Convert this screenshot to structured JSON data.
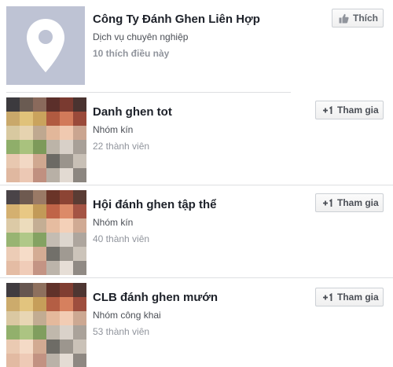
{
  "items": [
    {
      "kind": "page",
      "title": "Công Ty Đánh Ghen Liên Hợp",
      "subtitle": "Dịch vụ chuyên nghiệp",
      "meta": "10 thích điều này",
      "action_label": "Thích",
      "action_icon": "thumbs-up-icon",
      "thumbnail_icon": "map-pin-icon"
    },
    {
      "kind": "group",
      "title": "Danh ghen tot",
      "subtitle": "Nhóm kín",
      "meta": "22 thành viên",
      "action_label": "Tham gia",
      "action_icon": "plus-one-icon"
    },
    {
      "kind": "group",
      "title": "Hội đánh ghen tập thể",
      "subtitle": "Nhóm kín",
      "meta": "40 thành viên",
      "action_label": "Tham gia",
      "action_icon": "plus-one-icon"
    },
    {
      "kind": "group",
      "title": "CLB đánh ghen mướn",
      "subtitle": "Nhóm công khai",
      "meta": "53 thành viên",
      "action_label": "Tham gia",
      "action_icon": "plus-one-icon"
    }
  ],
  "colors": {
    "page_thumb_bg": "#bec3d4",
    "title": "#1d2129",
    "secondary_text": "#4b4f56",
    "meta_text": "#90949c"
  }
}
